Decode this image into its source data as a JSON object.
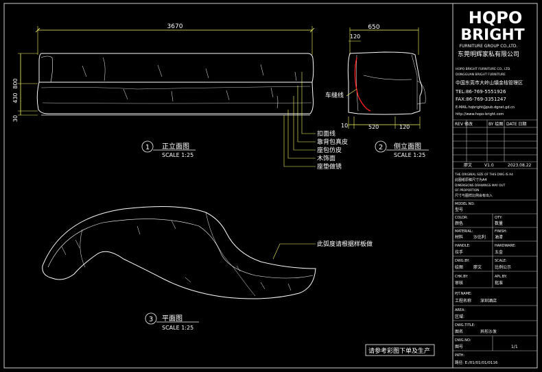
{
  "logo": {
    "brand_top": "HQPO",
    "brand_bottom": "BRIGHT",
    "brand_sub": "FURNITURE GROUP CO.,LTD.",
    "company_cn": "东莞明辉家私有限公司"
  },
  "company_info": {
    "line1": "HOPO BRIGHT FURNITURE CO., LTD.",
    "line2": "DONGGUAN BRIGHT FURNITURE",
    "address": "中国东莞市大岭山镇金桔管理区",
    "tel": "TEL:86-769-5551926",
    "fax": "FAX:86-769-3351247",
    "email": "E-MAIL:hqbright@pub.dgnet.gd.cn",
    "web": "http://www.hopo-bright.com"
  },
  "revision_header": {
    "rev": "REV 修改",
    "by": "BY 绘图",
    "date": "DATE 日期"
  },
  "title_block": {
    "drafter_label": "廖文",
    "version": "V1.0",
    "ver_date": "2023.08.22",
    "note1": "THE ORIGINAL SIZE OF THIS DWG IS A4",
    "note2": "此图纸原稿尺寸为A4",
    "note3": "DIMENSIONS DRAWINGS MAY OUT",
    "note4": "OF PROPORTION",
    "note5": "尺寸与图样比例会有出入",
    "model_label": "MODEL NO:",
    "model_cn": "型号",
    "color_label": "COLOR:",
    "color_cn": "颜色",
    "qty_label": "QTY:",
    "qty_val": "数量",
    "material_label": "MATERIAL:",
    "material_cn": "材料",
    "material_val": "沙比利",
    "finish_label": "FINISH:",
    "finish_val": "油漆",
    "handle_label": "HANDLE:",
    "handle_cn": "拉手",
    "hardware_label": "HARDWARE:",
    "hardware_cn": "五金",
    "dwg_label": "DWG.BY:",
    "dwg_cn": "绘图",
    "dwg_val": "廖文",
    "scale_label": "SCALE:",
    "scale_cn": "比例公示",
    "chk_label": "CHK.BY:",
    "chk_cn": "审核",
    "apl_label": "APL.BY:",
    "apl_cn": "批准",
    "project_label": "PJT.NAME:",
    "project_cn": "工程名称",
    "project_val": "深圳酒店",
    "area_label": "AREA:",
    "area_cn": "区域:",
    "dwg_title_label": "DWG.TITLE:",
    "dwg_title_cn": "图名",
    "dwg_title_val": "异形沙发",
    "dwg_no_label": "DWG.NO:",
    "dwg_no_cn": "图号",
    "sheet_val": "1/1",
    "path_label": "PATH:",
    "path_val": "路径: E:/01/01/01/0116"
  },
  "front_view": {
    "num": "1",
    "title": "正立面图",
    "scale": "SCALE 1:25",
    "dim_width": "3670",
    "dim_height": "800",
    "dim_seat": "430",
    "dim_base": "30"
  },
  "side_view": {
    "num": "2",
    "title": "侧立面图",
    "scale": "SCALE 1:25",
    "dim_depth": "650",
    "dim_back": "120",
    "dim_left": "10",
    "dim_mid": "520",
    "dim_right": "120",
    "seam_label": "车缝线"
  },
  "plan_view": {
    "num": "3",
    "title": "平面图",
    "scale": "SCALE 1:25",
    "note": "此弧度请根据样板做"
  },
  "callouts": [
    "扣面线",
    "靠背包真皮",
    "座包仿皮",
    "木饰面",
    "座垫做锈"
  ],
  "footer_note": "请参考彩图下单及生产",
  "colors": {
    "background": "#000000",
    "line": "#ffffff",
    "dimension": "#ffff66",
    "red": "#ff2020",
    "grid": "#c0c0c0"
  }
}
